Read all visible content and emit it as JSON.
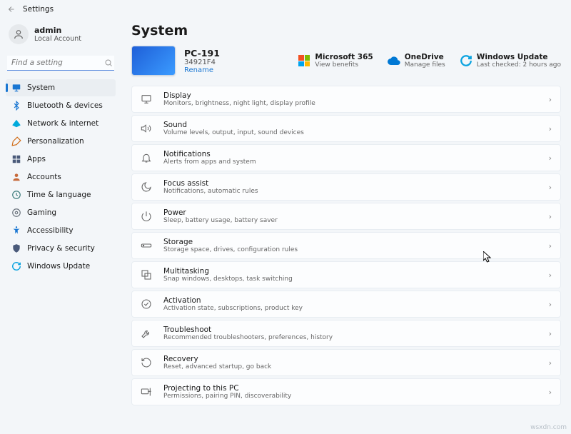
{
  "titlebar": {
    "label": "Settings"
  },
  "user": {
    "name": "admin",
    "sub": "Local Account"
  },
  "search": {
    "placeholder": "Find a setting"
  },
  "nav": {
    "items": [
      {
        "label": "System",
        "icon": "display",
        "color": "#1976d2",
        "active": true
      },
      {
        "label": "Bluetooth & devices",
        "icon": "bluetooth",
        "color": "#1976d2"
      },
      {
        "label": "Network & internet",
        "icon": "wifi",
        "color": "#00aadc"
      },
      {
        "label": "Personalization",
        "icon": "brush",
        "color": "#d06a14"
      },
      {
        "label": "Apps",
        "icon": "grid",
        "color": "#4a5a7a"
      },
      {
        "label": "Accounts",
        "icon": "person",
        "color": "#c76a3b"
      },
      {
        "label": "Time & language",
        "icon": "clock",
        "color": "#3a7a7a"
      },
      {
        "label": "Gaming",
        "icon": "game",
        "color": "#6a737d"
      },
      {
        "label": "Accessibility",
        "icon": "accessibility",
        "color": "#1976d2"
      },
      {
        "label": "Privacy & security",
        "icon": "shield",
        "color": "#4a5a7a"
      },
      {
        "label": "Windows Update",
        "icon": "update",
        "color": "#0aa3e0"
      }
    ]
  },
  "page": {
    "title": "System"
  },
  "hero": {
    "pc_name": "PC-191",
    "device_id": "34921F4",
    "rename": "Rename",
    "tiles": [
      {
        "icon": "m365",
        "title": "Microsoft 365",
        "sub": "View benefits"
      },
      {
        "icon": "onedrive",
        "title": "OneDrive",
        "sub": "Manage files"
      },
      {
        "icon": "update",
        "title": "Windows Update",
        "sub": "Last checked: 2 hours ago"
      }
    ]
  },
  "cards": [
    {
      "icon": "display",
      "title": "Display",
      "sub": "Monitors, brightness, night light, display profile"
    },
    {
      "icon": "sound",
      "title": "Sound",
      "sub": "Volume levels, output, input, sound devices"
    },
    {
      "icon": "bell",
      "title": "Notifications",
      "sub": "Alerts from apps and system"
    },
    {
      "icon": "moon",
      "title": "Focus assist",
      "sub": "Notifications, automatic rules"
    },
    {
      "icon": "power",
      "title": "Power",
      "sub": "Sleep, battery usage, battery saver"
    },
    {
      "icon": "storage",
      "title": "Storage",
      "sub": "Storage space, drives, configuration rules"
    },
    {
      "icon": "multitask",
      "title": "Multitasking",
      "sub": "Snap windows, desktops, task switching"
    },
    {
      "icon": "activation",
      "title": "Activation",
      "sub": "Activation state, subscriptions, product key"
    },
    {
      "icon": "troubleshoot",
      "title": "Troubleshoot",
      "sub": "Recommended troubleshooters, preferences, history"
    },
    {
      "icon": "recovery",
      "title": "Recovery",
      "sub": "Reset, advanced startup, go back"
    },
    {
      "icon": "project",
      "title": "Projecting to this PC",
      "sub": "Permissions, pairing PIN, discoverability"
    }
  ],
  "watermark": "wsxdn.com"
}
